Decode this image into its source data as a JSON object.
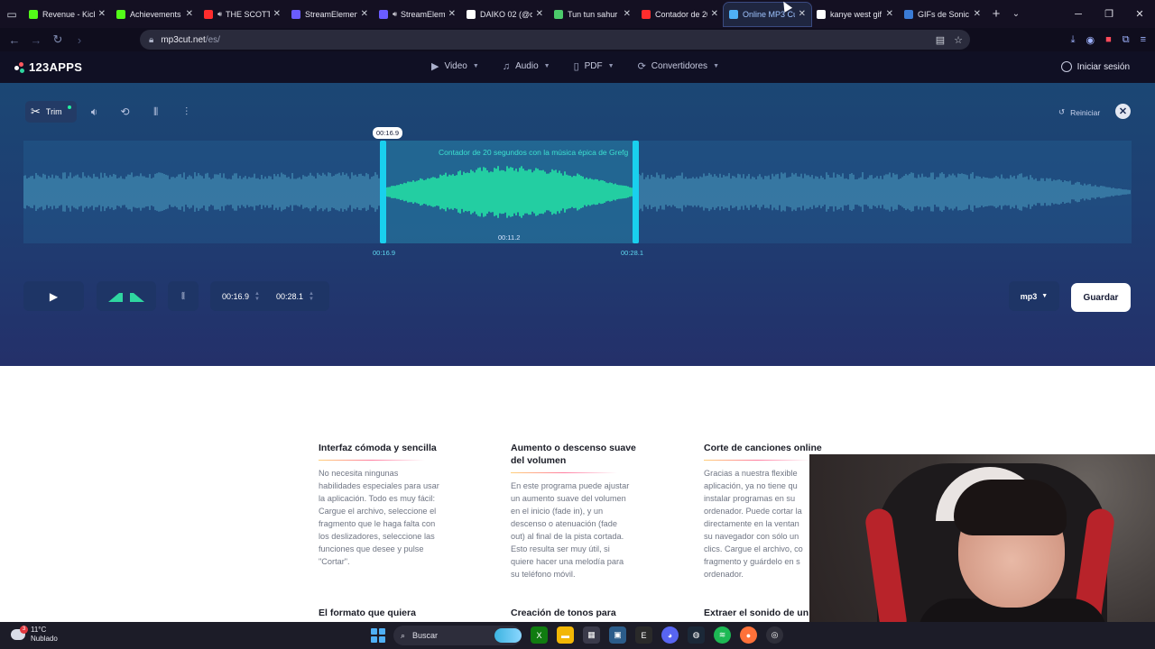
{
  "browser": {
    "tabs": [
      {
        "label": "Revenue - Kick D",
        "fav": "#53fc18",
        "icon": "kick-icon"
      },
      {
        "label": "Achievements - I",
        "fav": "#53fc18",
        "icon": "kick-icon"
      },
      {
        "label": "THE SCOTTS",
        "fav": "#ff2d2d",
        "icon": "youtube-icon",
        "audio": true
      },
      {
        "label": "StreamElements",
        "fav": "#6a5cff",
        "icon": "streamelements-icon"
      },
      {
        "label": "StreamElem",
        "fav": "#6a5cff",
        "icon": "streamelements-icon",
        "audio": true
      },
      {
        "label": "DAIKO 02 (@dai",
        "fav": "#ffffff",
        "icon": "tiktok-icon"
      },
      {
        "label": "Tun tun sahur G",
        "fav": "#4ccb6b",
        "icon": "gif-icon"
      },
      {
        "label": "Contador de 20",
        "fav": "#ff2d2d",
        "icon": "youtube-icon"
      },
      {
        "label": "Online MP3 Cut",
        "fav": "#4fb0f5",
        "icon": "mp3cut-icon",
        "active": true
      },
      {
        "label": "kanye west gif -",
        "fav": "#ffffff",
        "icon": "google-icon"
      },
      {
        "label": "GIFs de Sonic G",
        "fav": "#3a7bd5",
        "icon": "gif-icon"
      }
    ],
    "url_host": "mp3cut.net",
    "url_path": "/es/"
  },
  "site": {
    "logo": "123APPS",
    "menu": [
      {
        "label": "Video",
        "icon": "video-icon"
      },
      {
        "label": "Audio",
        "icon": "music-icon"
      },
      {
        "label": "PDF",
        "icon": "document-icon"
      },
      {
        "label": "Convertidores",
        "icon": "convert-icon"
      }
    ],
    "login": "Iniciar sesión"
  },
  "editor": {
    "trim_label": "Trim",
    "reset_label": "Reiniciar",
    "track_title": "Contador de 20 segundos con la música épica de Grefg",
    "start_pill": "00:16.9",
    "start_time": "00:16.9",
    "end_time": "00:28.1",
    "duration": "00:11.2",
    "input_start": "00:16.9",
    "input_end": "00:28.1",
    "format": "mp3",
    "save_label": "Guardar",
    "selection_start": 0.3245,
    "selection_end": 0.5525
  },
  "features": [
    {
      "title": "Interfaz cómoda y sencilla",
      "lines": [
        "No necesita ningunas",
        "habilidades especiales para usar",
        "la aplicación. Todo es muy fácil:",
        "Cargue el archivo, seleccione el",
        "fragmento que le haga falta con",
        "los deslizadores, seleccione las",
        "funciones que desee y pulse",
        "\"Cortar\"."
      ]
    },
    {
      "title": "Aumento o descenso suave del volumen",
      "lines": [
        "En este programa puede ajustar",
        "un aumento suave del volumen",
        "en el inicio (fade in), y un",
        "descenso o atenuación (fade",
        "out) al final de la pista cortada.",
        "Esto resulta ser muy útil, si",
        "quiere hacer una melodía para",
        "su teléfono móvil."
      ]
    },
    {
      "title": "Corte de canciones online",
      "lines": [
        "Gracias a nuestra flexible",
        "aplicación, ya no tiene qu",
        "instalar programas en su",
        "ordenador. Puede cortar la",
        "directamente en la ventan",
        "su navegador con sólo un",
        "clics. Cargue el archivo, co",
        "fragmento y guárdelo en s",
        "ordenador."
      ]
    }
  ],
  "features_row2": [
    "El formato que quiera",
    "Creación de tonos para",
    "Extraer el sonido de un"
  ],
  "taskbar": {
    "temperature": "11°C",
    "condition": "Nublado",
    "weather_badge": "3",
    "search_label": "Buscar"
  }
}
